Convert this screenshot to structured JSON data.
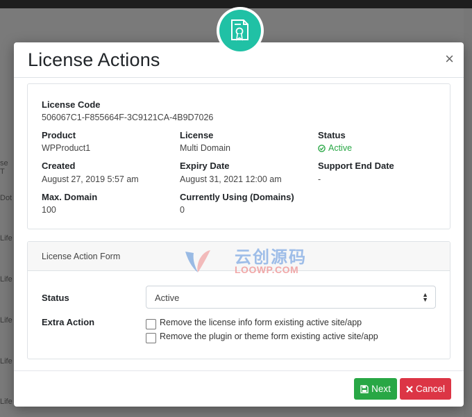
{
  "modal": {
    "title": "License Actions",
    "close_label": "×"
  },
  "details": {
    "license_code_label": "License Code",
    "license_code": "506067C1-F855664F-3C9121CA-4B9D7026",
    "product_label": "Product",
    "product": "WPProduct1",
    "license_label": "License",
    "license": "Multi Domain",
    "status_label": "Status",
    "status": "Active",
    "created_label": "Created",
    "created": "August 27, 2019 5:57 am",
    "expiry_label": "Expiry Date",
    "expiry": "August 31, 2021 12:00 am",
    "support_end_label": "Support End Date",
    "support_end": "-",
    "max_domain_label": "Max. Domain",
    "max_domain": "100",
    "using_label": "Currently Using (Domains)",
    "using": "0"
  },
  "form": {
    "header": "License Action Form",
    "status_label": "Status",
    "status_value": "Active",
    "extra_action_label": "Extra Action",
    "option1": "Remove the license info form existing active site/app",
    "option2": "Remove the plugin or theme form existing active site/app"
  },
  "buttons": {
    "next": "Next",
    "cancel": "Cancel"
  },
  "background": {
    "col_header_fragment": "se T",
    "rows": [
      "Dot",
      "Life",
      "Life",
      "Life",
      "Life",
      "Life"
    ]
  },
  "watermark": {
    "cn_text": "云创源码",
    "en_text": "LOOWP.COM"
  },
  "colors": {
    "accent_teal": "#20c1a5",
    "success": "#28a745",
    "danger": "#dc3545"
  },
  "icons": {
    "badge": "certificate-icon",
    "status": "check-circle-icon",
    "next": "save-icon",
    "cancel": "times-icon"
  }
}
